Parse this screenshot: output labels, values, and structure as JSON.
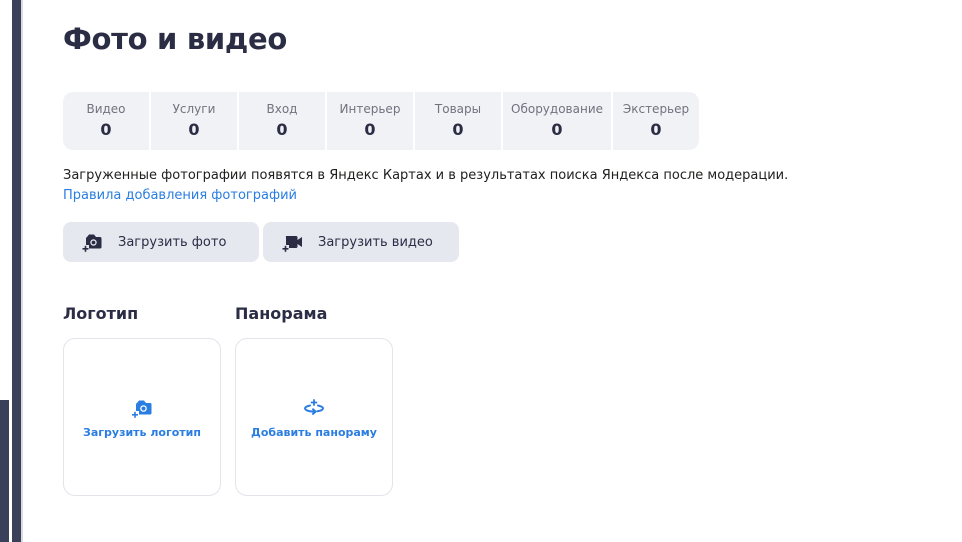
{
  "page": {
    "title": "Фото и видео"
  },
  "stats": [
    {
      "label": "Видео",
      "value": "0"
    },
    {
      "label": "Услуги",
      "value": "0"
    },
    {
      "label": "Вход",
      "value": "0"
    },
    {
      "label": "Интерьер",
      "value": "0"
    },
    {
      "label": "Товары",
      "value": "0"
    },
    {
      "label": "Оборудование",
      "value": "0"
    },
    {
      "label": "Экстерьер",
      "value": "0"
    }
  ],
  "moderation_note": "Загруженные фотографии появятся в Яндекс Картах и в результатах поиска Яндекса после модерации.",
  "rules_link": "Правила добавления фотографий",
  "buttons": {
    "upload_photo": "Загрузить фото",
    "upload_video": "Загрузить видео"
  },
  "logo": {
    "title": "Логотип",
    "action": "Загрузить логотип"
  },
  "panorama": {
    "title": "Панорама",
    "action": "Добавить панораму"
  },
  "colors": {
    "accent": "#2a7de1",
    "heading": "#2b2d45",
    "tile_bg": "#f1f2f6",
    "button_bg": "#e6e8ef"
  },
  "icons": {
    "upload_photo": "camera-plus-icon",
    "upload_video": "video-camera-plus-icon",
    "logo": "camera-plus-icon",
    "panorama": "panorama-rotate-icon"
  }
}
